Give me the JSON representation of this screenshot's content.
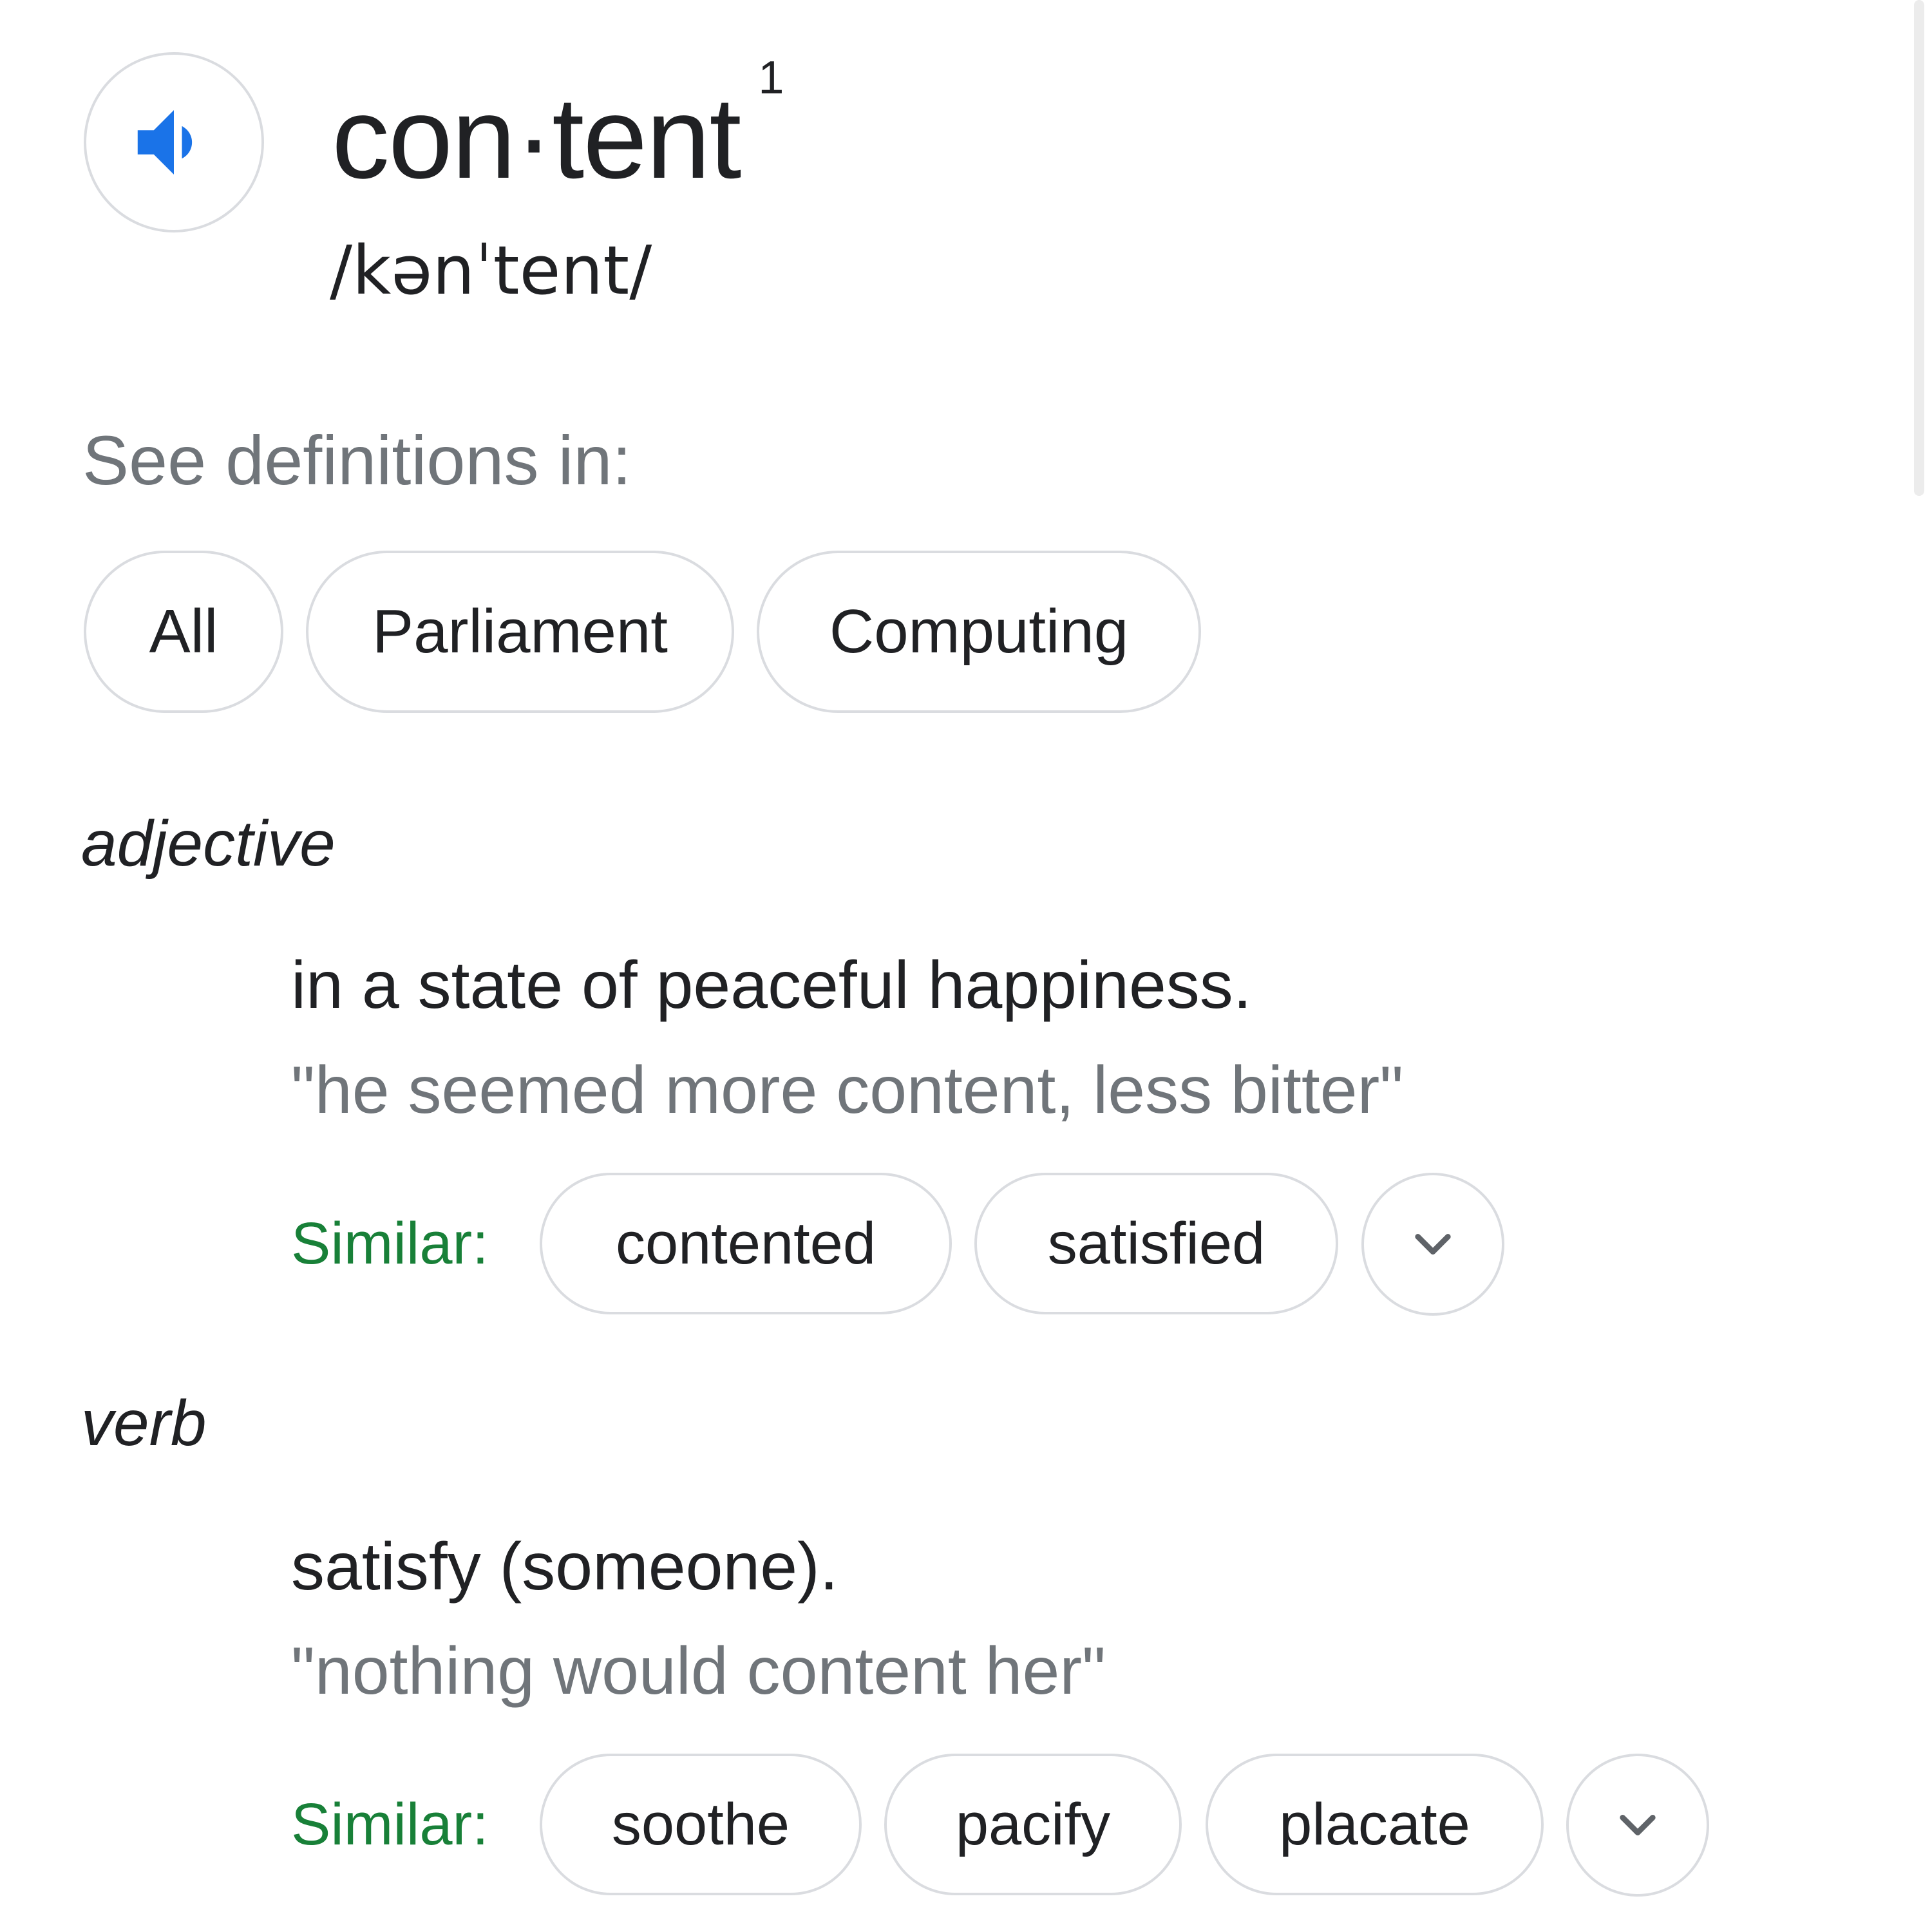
{
  "entry": {
    "headword": "con·tent",
    "superscript": "1",
    "pronunciation": "/kənˈtent/",
    "audio_icon": "speaker-icon"
  },
  "see_definitions": {
    "label": "See definitions in:",
    "filters": [
      "All",
      "Parliament",
      "Computing"
    ]
  },
  "senses": [
    {
      "part_of_speech": "adjective",
      "definition": "in a state of peaceful happiness.",
      "example": "\"he seemed more content, less bitter\"",
      "similar_label": "Similar:",
      "similar": [
        "contented",
        "satisfied"
      ],
      "more_icon": "chevron-down-icon"
    },
    {
      "part_of_speech": "verb",
      "definition": "satisfy (someone).",
      "example": "\"nothing would content her\"",
      "similar_label": "Similar:",
      "similar": [
        "soothe",
        "pacify",
        "placate"
      ],
      "more_icon": "chevron-down-icon"
    }
  ],
  "colors": {
    "accent_blue": "#1a73e8",
    "similar_green": "#188038",
    "text_primary": "#202124",
    "text_secondary": "#70757a",
    "chip_border": "#dadce0"
  }
}
